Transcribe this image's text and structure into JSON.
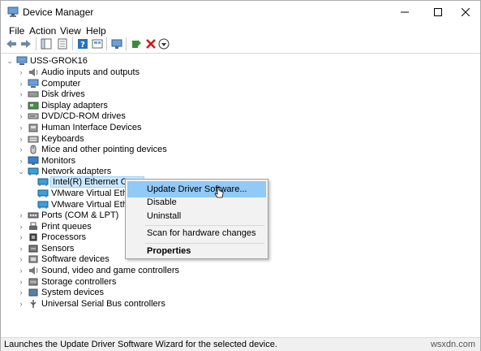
{
  "window": {
    "title": "Device Manager",
    "controls": {
      "minimize": "—",
      "maximize": "☐",
      "close": "✕"
    }
  },
  "menu": [
    "File",
    "Action",
    "View",
    "Help"
  ],
  "toolbar": [
    "back-icon",
    "forward-icon",
    "show-hide-console-tree-icon",
    "properties-icon",
    "help-icon",
    "view-icon",
    "scan-hardware-icon",
    "update-driver-icon",
    "uninstall-icon",
    "download-icon"
  ],
  "tree": {
    "root": "USS-GROK16",
    "items": [
      {
        "label": "Audio inputs and outputs",
        "icon": "audio-icon"
      },
      {
        "label": "Computer",
        "icon": "computer-icon"
      },
      {
        "label": "Disk drives",
        "icon": "disk-icon"
      },
      {
        "label": "Display adapters",
        "icon": "display-icon"
      },
      {
        "label": "DVD/CD-ROM drives",
        "icon": "dvd-icon"
      },
      {
        "label": "Human Interface Devices",
        "icon": "hid-icon"
      },
      {
        "label": "Keyboards",
        "icon": "keyboard-icon"
      },
      {
        "label": "Mice and other pointing devices",
        "icon": "mouse-icon"
      },
      {
        "label": "Monitors",
        "icon": "monitor-icon"
      },
      {
        "label": "Network adapters",
        "icon": "network-icon"
      }
    ],
    "network_children": [
      {
        "label": "Intel(R) Ethernet Conn"
      },
      {
        "label": "VMware Virtual Ethern"
      },
      {
        "label": "VMware Virtual Ethern"
      }
    ],
    "items_after": [
      {
        "label": "Ports (COM & LPT)",
        "icon": "port-icon"
      },
      {
        "label": "Print queues",
        "icon": "printer-icon"
      },
      {
        "label": "Processors",
        "icon": "processor-icon"
      },
      {
        "label": "Sensors",
        "icon": "sensor-icon"
      },
      {
        "label": "Software devices",
        "icon": "software-icon"
      },
      {
        "label": "Sound, video and game controllers",
        "icon": "sound-icon"
      },
      {
        "label": "Storage controllers",
        "icon": "storage-icon"
      },
      {
        "label": "System devices",
        "icon": "system-icon"
      },
      {
        "label": "Universal Serial Bus controllers",
        "icon": "usb-icon"
      }
    ]
  },
  "context_menu": {
    "update": "Update Driver Software...",
    "disable": "Disable",
    "uninstall": "Uninstall",
    "scan": "Scan for hardware changes",
    "properties": "Properties"
  },
  "status": "Launches the Update Driver Software Wizard for the selected device.",
  "watermark": "wsxdn.com",
  "colors": {
    "highlight": "#91c9f7",
    "selection": "#cce8ff",
    "device_blue": "#2a78c8"
  }
}
